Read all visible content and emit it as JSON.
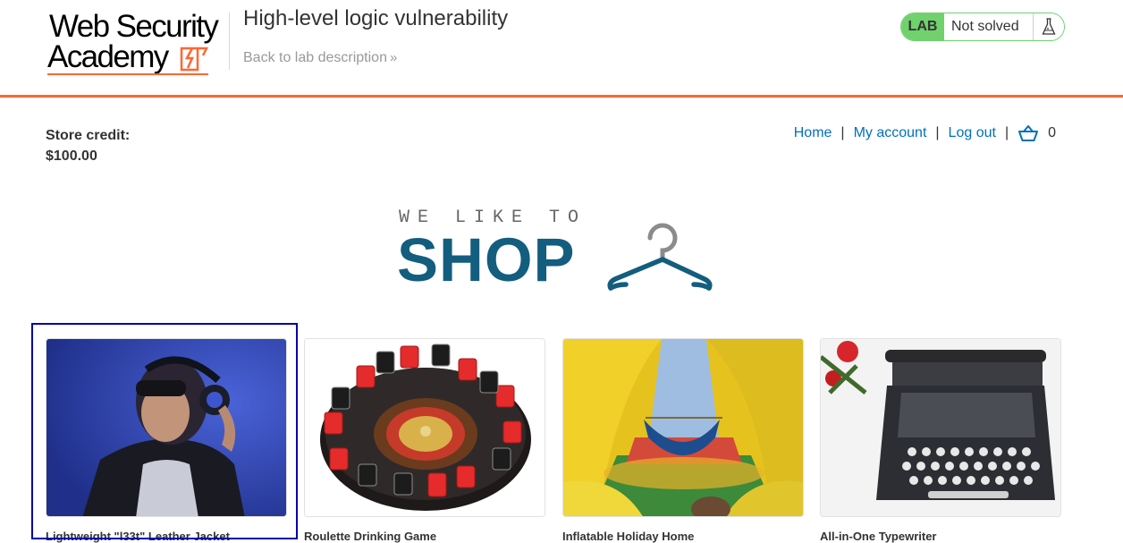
{
  "header": {
    "logo": {
      "line1": "Web Security",
      "line2": "Academy"
    },
    "lab_title": "High-level logic vulnerability",
    "back_link": "Back to lab description",
    "lab_badge": "LAB",
    "lab_status": "Not solved",
    "colors": {
      "accent": "#ff6633",
      "solved_green": "#70d16d"
    }
  },
  "store": {
    "credit_label": "Store credit:",
    "credit_value": "$100.00"
  },
  "nav": {
    "home": "Home",
    "my_account": "My account",
    "log_out": "Log out",
    "separator": "|",
    "cart_count": "0",
    "link_color": "#0071bc"
  },
  "banner": {
    "tagline": "WE LIKE TO",
    "headline": "SHOP",
    "color": "#135d7f"
  },
  "products": [
    {
      "name": "Lightweight \"l33t\" Leather Jacket"
    },
    {
      "name": "Roulette Drinking Game"
    },
    {
      "name": "Inflatable Holiday Home"
    },
    {
      "name": "All-in-One Typewriter"
    }
  ]
}
